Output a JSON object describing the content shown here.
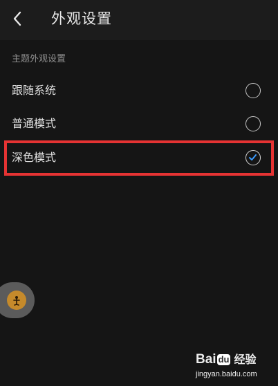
{
  "header": {
    "title": "外观设置",
    "back_icon": "chevron-left-icon"
  },
  "theme_section": {
    "label": "主题外观设置",
    "options": [
      {
        "label": "跟随系统",
        "selected": false
      },
      {
        "label": "普通模式",
        "selected": false
      },
      {
        "label": "深色模式",
        "selected": true
      }
    ]
  },
  "floating_ball": {
    "icon": "assistant-icon",
    "color": "#c58a2b"
  },
  "watermark": {
    "brand_prefix": "Bai",
    "brand_du": "du",
    "brand_suffix": "经验",
    "url": "jingyan.baidu.com"
  },
  "colors": {
    "background": "#151515",
    "header": "#1c1c1c",
    "highlight": "#e53333",
    "check": "#3b9cff"
  }
}
